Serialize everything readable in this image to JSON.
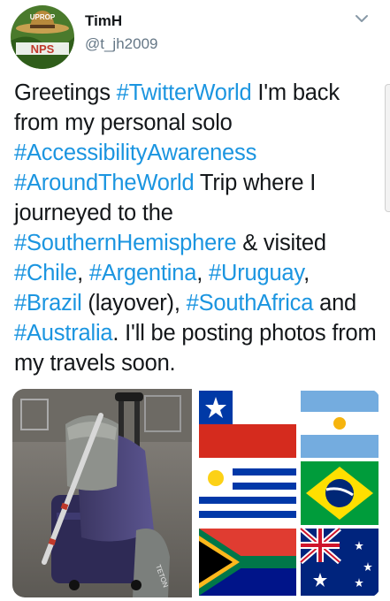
{
  "user": {
    "name": "TimH",
    "handle": "@t_jh2009",
    "avatar_text_top": "UPROP",
    "avatar_text_bottom": "NPS"
  },
  "tweet": {
    "segments": [
      {
        "text": "Greetings ",
        "tag": false
      },
      {
        "text": "#TwitterWorld",
        "tag": true
      },
      {
        "text": " I'm back from my personal solo ",
        "tag": false
      },
      {
        "text": "#AccessibilityAwareness",
        "tag": true
      },
      {
        "text": " ",
        "tag": false
      },
      {
        "text": "#AroundTheWorld",
        "tag": true
      },
      {
        "text": " Trip where I journeyed to the ",
        "tag": false
      },
      {
        "text": "#SouthernHemisphere",
        "tag": true
      },
      {
        "text": " & visited ",
        "tag": false
      },
      {
        "text": "#Chile",
        "tag": true
      },
      {
        "text": ", ",
        "tag": false
      },
      {
        "text": "#Argentina",
        "tag": true
      },
      {
        "text": ", ",
        "tag": false
      },
      {
        "text": "#Uruguay",
        "tag": true
      },
      {
        "text": ", ",
        "tag": false
      },
      {
        "text": "#Brazil",
        "tag": true
      },
      {
        "text": " (layover), ",
        "tag": false
      },
      {
        "text": "#SouthAfrica",
        "tag": true
      },
      {
        "text": " and ",
        "tag": false
      },
      {
        "text": "#Australia",
        "tag": true
      },
      {
        "text": ". I'll be posting photos from my travels soon.",
        "tag": false
      }
    ]
  },
  "media": {
    "photo1_caption": "TETON"
  },
  "colors": {
    "link": "#1b95e0",
    "text": "#14171a",
    "secondary": "#657786"
  },
  "icons": {
    "menu": "chevron-down-icon"
  }
}
